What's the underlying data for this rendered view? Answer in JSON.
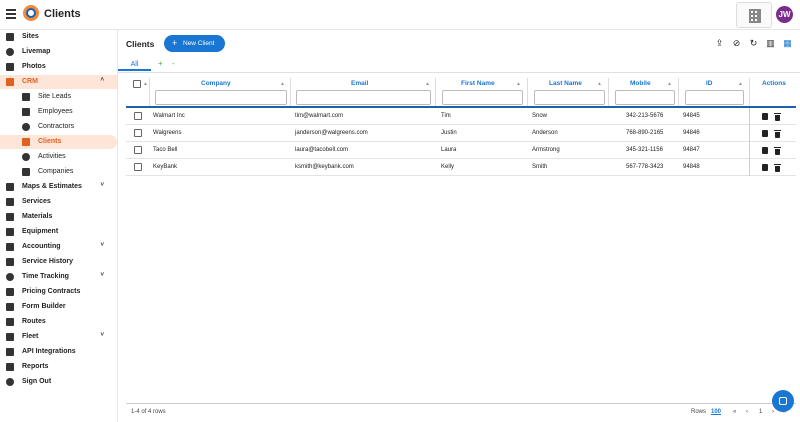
{
  "app": {
    "title": "Clients",
    "avatar_initials": "JW"
  },
  "icons": {
    "brand_accent": "#e06020",
    "primary": "#1976d2",
    "avatar_bg": "#7b2d8e"
  },
  "sidebar": {
    "items": [
      {
        "label": "Sites",
        "icon": "folder-icon"
      },
      {
        "label": "Livemap",
        "icon": "globe-icon"
      },
      {
        "label": "Photos",
        "icon": "image-icon"
      },
      {
        "label": "CRM",
        "icon": "crm-icon",
        "chevron": "˄"
      },
      {
        "label": "Site Leads",
        "icon": "folder-icon"
      },
      {
        "label": "Employees",
        "icon": "id-card-icon"
      },
      {
        "label": "Contractors",
        "icon": "person-icon"
      },
      {
        "label": "Clients",
        "icon": "pencil-icon"
      },
      {
        "label": "Activities",
        "icon": "clock-icon"
      },
      {
        "label": "Companies",
        "icon": "folder-icon"
      },
      {
        "label": "Maps & Estimates",
        "icon": "map-icon",
        "chevron": "˅"
      },
      {
        "label": "Services",
        "icon": "wrench-icon"
      },
      {
        "label": "Materials",
        "icon": "layers-icon"
      },
      {
        "label": "Equipment",
        "icon": "equipment-icon"
      },
      {
        "label": "Accounting",
        "icon": "accounting-icon",
        "chevron": "˅"
      },
      {
        "label": "Service History",
        "icon": "monitor-icon"
      },
      {
        "label": "Time Tracking",
        "icon": "timer-icon",
        "chevron": "˅"
      },
      {
        "label": "Pricing Contracts",
        "icon": "dollar-icon"
      },
      {
        "label": "Form Builder",
        "icon": "form-icon"
      },
      {
        "label": "Routes",
        "icon": "route-icon"
      },
      {
        "label": "Fleet",
        "icon": "truck-icon",
        "chevron": "˅"
      },
      {
        "label": "API Integrations",
        "icon": "link-icon"
      },
      {
        "label": "Reports",
        "icon": "report-icon"
      },
      {
        "label": "Sign Out",
        "icon": "power-icon"
      }
    ]
  },
  "main": {
    "title": "Clients",
    "new_button": "New Client",
    "new_button_icon": "+",
    "tabs": {
      "all": "All",
      "add": "+",
      "remove": "-"
    },
    "toolbar_glyphs": {
      "upload": "⇪",
      "filter_off": "⊘",
      "refresh": "↻",
      "columns": "▥",
      "view": "▦"
    }
  },
  "table": {
    "columns": [
      "Company",
      "Email",
      "First Name",
      "Last Name",
      "Mobile",
      "ID",
      "Actions"
    ],
    "sort_glyph": "▲",
    "rows": [
      {
        "company": "Walmart Inc",
        "email": "tim@walmart.com",
        "first": "Tim",
        "last": "Snow",
        "mobile": "342-213-5676",
        "id": "94845"
      },
      {
        "company": "Walgreens",
        "email": "janderson@walgreens.com",
        "first": "Justin",
        "last": "Anderson",
        "mobile": "768-890-2165",
        "id": "94846"
      },
      {
        "company": "Taco Bell",
        "email": "laura@tacobell.com",
        "first": "Laura",
        "last": "Armstrong",
        "mobile": "345-321-1156",
        "id": "94847"
      },
      {
        "company": "KeyBank",
        "email": "ksmith@keybank.com",
        "first": "Kelly",
        "last": "Smith",
        "mobile": "567-778-3423",
        "id": "94848"
      }
    ]
  },
  "footer": {
    "summary": "1-4 of 4 rows",
    "rows_label": "Rows",
    "rows_value": "100",
    "first_glyph": "«",
    "prev_glyph": "‹",
    "page": "1",
    "next_glyph": "›",
    "last_glyph": "»"
  }
}
